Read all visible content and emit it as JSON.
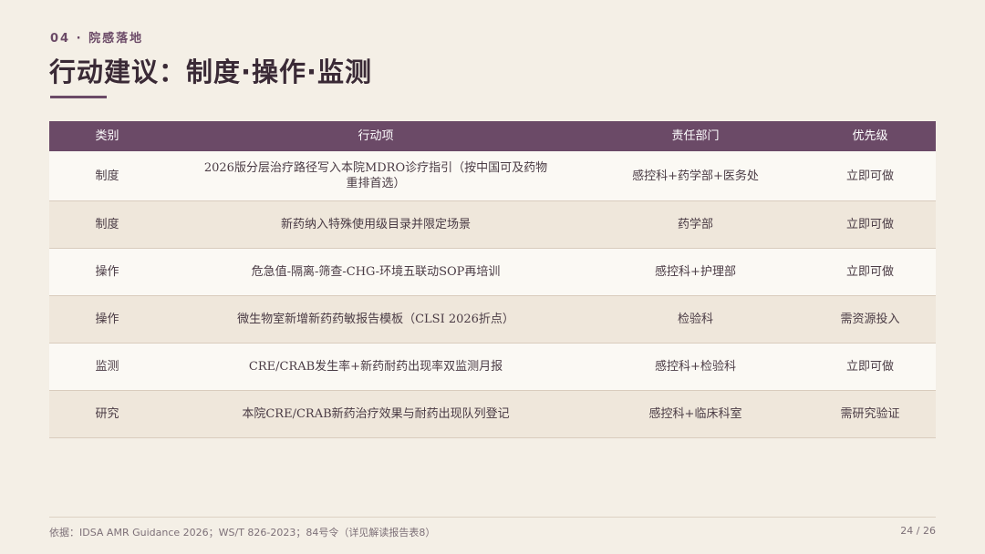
{
  "header": {
    "eyebrow": "04 · 院感落地",
    "title": "行动建议：制度·操作·监测"
  },
  "table": {
    "columns": [
      "类别",
      "行动项",
      "责任部门",
      "优先级"
    ],
    "rows": [
      {
        "category": "制度",
        "action": "2026版分层治疗路径写入本院MDRO诊疗指引（按中国可及药物重排首选）",
        "dept": "感控科+药学部+医务处",
        "priority": "立即可做"
      },
      {
        "category": "制度",
        "action": "新药纳入特殊使用级目录并限定场景",
        "dept": "药学部",
        "priority": "立即可做"
      },
      {
        "category": "操作",
        "action": "危急值-隔离-筛查-CHG-环境五联动SOP再培训",
        "dept": "感控科+护理部",
        "priority": "立即可做"
      },
      {
        "category": "操作",
        "action": "微生物室新增新药药敏报告模板（CLSI 2026折点）",
        "dept": "检验科",
        "priority": "需资源投入"
      },
      {
        "category": "监测",
        "action": "CRE/CRAB发生率+新药耐药出现率双监测月报",
        "dept": "感控科+检验科",
        "priority": "立即可做"
      },
      {
        "category": "研究",
        "action": "本院CRE/CRAB新药治疗效果与耐药出现队列登记",
        "dept": "感控科+临床科室",
        "priority": "需研究验证"
      }
    ]
  },
  "footer": {
    "source": "依据：IDSA AMR Guidance 2026；WS/T 826-2023；84号令（详见解读报告表8）",
    "page": "24 / 26"
  },
  "colors": {
    "accent": "#6b4a67",
    "background": "#f4efe6",
    "row_light": "#fbf9f4",
    "row_dark": "#efe7db"
  }
}
